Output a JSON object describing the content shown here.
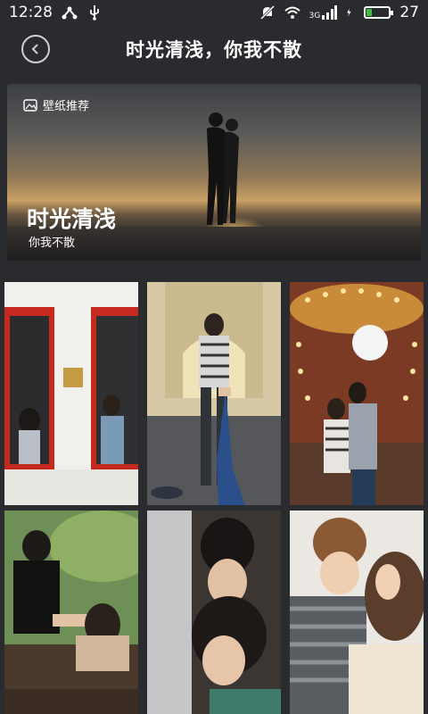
{
  "status_bar": {
    "time": "12:28",
    "network_label": "3G",
    "battery_level": "27",
    "battery_fraction": 0.27
  },
  "header": {
    "title": "时光清浅，你我不散",
    "back_icon": "back-arrow-icon"
  },
  "banner": {
    "tag": "壁纸推荐",
    "tag_icon": "wallpaper-icon",
    "title": "时光清浅",
    "subtitle": "你我不散"
  },
  "wallpapers": [
    {
      "name": "couple-red-windows"
    },
    {
      "name": "holding-hands-street"
    },
    {
      "name": "carousel-kiss"
    },
    {
      "name": "couple-cafe-table"
    },
    {
      "name": "couple-window-pose"
    },
    {
      "name": "couple-sweater-hug"
    }
  ],
  "colors": {
    "background": "#2a2b2e",
    "battery_green": "#3fbf3f"
  }
}
